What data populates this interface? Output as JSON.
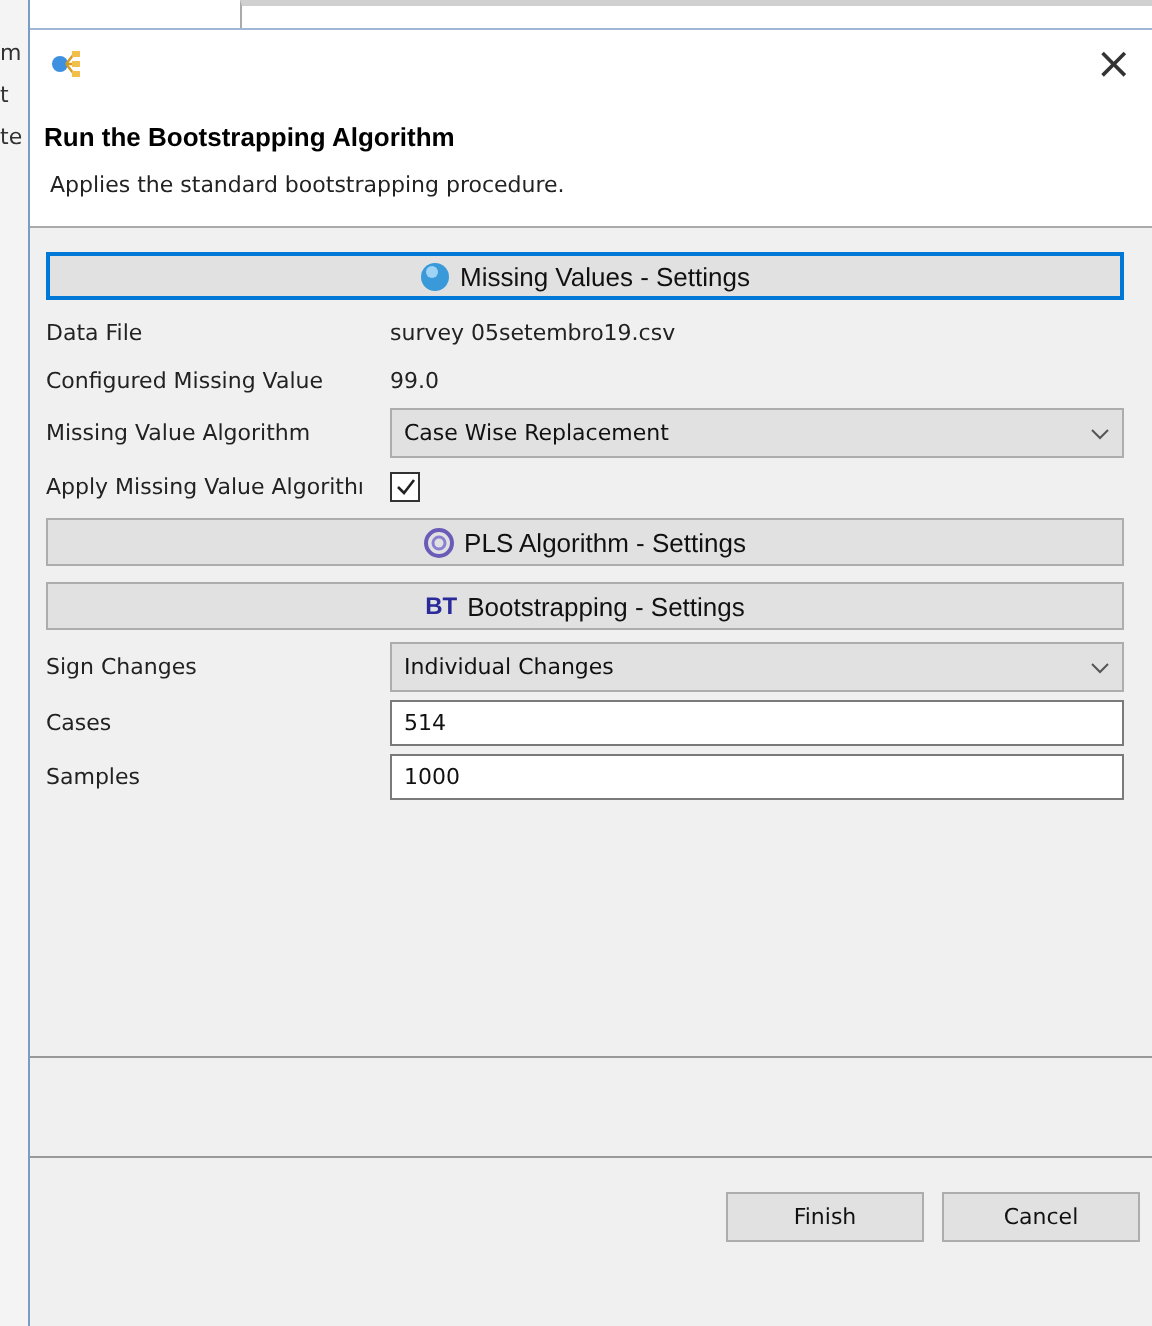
{
  "background": {
    "fragments": [
      "m",
      "t",
      "te"
    ]
  },
  "window": {
    "close_label": "×"
  },
  "header": {
    "title": "Run the Bootstrapping Algorithm",
    "description": "Applies the standard bootstrapping procedure."
  },
  "sections": [
    {
      "kind": "help",
      "label": "Missing Values - Settings",
      "focused": true,
      "rows": [
        {
          "kind": "text",
          "label": "Data File",
          "value": "survey 05setembro19.csv"
        },
        {
          "kind": "text",
          "label": "Configured Missing Value",
          "value": "99.0"
        },
        {
          "kind": "dropdown",
          "label": "Missing Value Algorithm",
          "value": "Case Wise Replacement"
        },
        {
          "kind": "checkbox",
          "label": "Apply Missing Value Algorithı",
          "checked": true
        }
      ]
    },
    {
      "kind": "pls",
      "label": "PLS Algorithm - Settings",
      "focused": false
    },
    {
      "kind": "badge",
      "badge": "BT",
      "label": "Bootstrapping - Settings",
      "focused": false,
      "rows": [
        {
          "kind": "dropdown",
          "label": "Sign Changes",
          "value": "Individual Changes"
        },
        {
          "kind": "input",
          "label": "Cases",
          "value": "514"
        },
        {
          "kind": "input",
          "label": "Samples",
          "value": "1000"
        }
      ]
    }
  ],
  "buttons": [
    {
      "label": "Finish"
    },
    {
      "label": "Cancel"
    }
  ]
}
